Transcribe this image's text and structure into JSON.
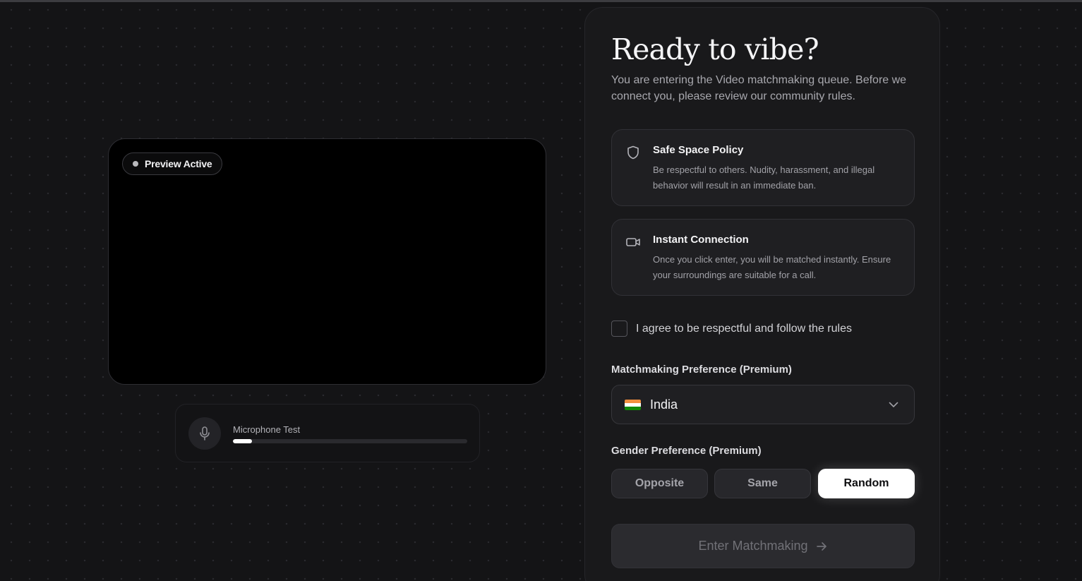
{
  "preview": {
    "badge": "Preview Active"
  },
  "mic": {
    "label": "Microphone Test",
    "level": 0.08
  },
  "panel": {
    "title": "Ready to vibe?",
    "subtitle": "You are entering the Video matchmaking queue. Before we connect you, please review our community rules.",
    "rules": [
      {
        "title": "Safe Space Policy",
        "text": "Be respectful to others. Nudity, harassment, and illegal behavior will result in an immediate ban.",
        "icon": "shield-icon"
      },
      {
        "title": "Instant Connection",
        "text": "Once you click enter, you will be matched instantly. Ensure your surroundings are suitable for a call.",
        "icon": "video-camera-icon"
      }
    ],
    "agree_label": "I agree to be respectful and follow the rules",
    "agree_checked": false,
    "matchmaking_label": "Matchmaking Preference (Premium)",
    "country": {
      "value": "India",
      "flag_colors": [
        "#f3903f",
        "#ffffff",
        "#128807"
      ]
    },
    "gender_label": "Gender Preference (Premium)",
    "gender_options": [
      "Opposite",
      "Same",
      "Random"
    ],
    "gender_selected": "Random",
    "enter_button": "Enter Matchmaking"
  }
}
